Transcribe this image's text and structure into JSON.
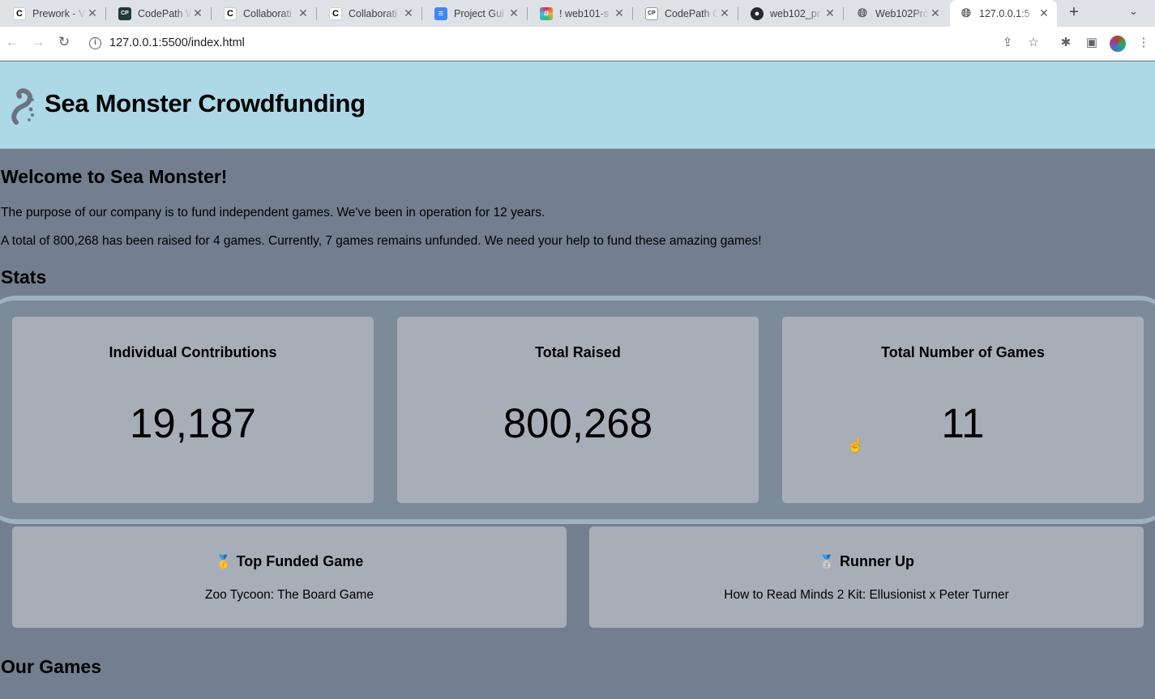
{
  "browser": {
    "tabs": [
      {
        "label": "Prework - V",
        "icon": "codepath-c-icon"
      },
      {
        "label": "CodePath W",
        "icon": "codepath-dark-icon"
      },
      {
        "label": "Collaborati",
        "icon": "codepath-c-icon"
      },
      {
        "label": "Collaborati",
        "icon": "codepath-c-icon"
      },
      {
        "label": "Project Gui",
        "icon": "google-docs-icon"
      },
      {
        "label": "! web101-s",
        "icon": "slack-icon"
      },
      {
        "label": "CodePath C",
        "icon": "codepath-light-icon"
      },
      {
        "label": "web102_pr",
        "icon": "github-icon"
      },
      {
        "label": "Web102Pro",
        "icon": "globe-icon"
      },
      {
        "label": "127.0.0.1:5",
        "icon": "globe-icon"
      }
    ],
    "url": "127.0.0.1:5500/index.html"
  },
  "header": {
    "title": "Sea Monster Crowdfunding"
  },
  "welcome": {
    "title": "Welcome to Sea Monster!",
    "description": "The purpose of our company is to fund independent games. We've been in operation for 12 years.",
    "summary": "A total of 800,268 has been raised for 4 games. Currently, 7 games remains unfunded. We need your help to fund these amazing games!"
  },
  "stats": {
    "title": "Stats",
    "cards": [
      {
        "label": "Individual Contributions",
        "value": "19,187"
      },
      {
        "label": "Total Raised",
        "value": "800,268"
      },
      {
        "label": "Total Number of Games",
        "value": "11"
      }
    ]
  },
  "top_games": {
    "first": {
      "medal": "🥇",
      "heading": "Top Funded Game",
      "name": "Zoo Tycoon: The Board Game"
    },
    "second": {
      "medal": "🥈",
      "heading": "Runner Up",
      "name": "How to Read Minds 2 Kit: Ellusionist x Peter Turner"
    }
  },
  "games": {
    "title": "Our Games"
  }
}
